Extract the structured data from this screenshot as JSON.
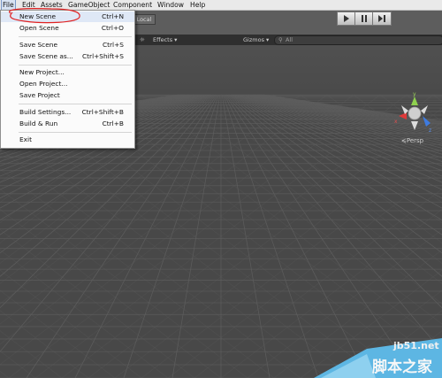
{
  "menubar": {
    "items": [
      "File",
      "Edit",
      "Assets",
      "GameObject",
      "Component",
      "Window",
      "Help"
    ]
  },
  "toolbar": {
    "play_icon": "play-icon",
    "pause_icon": "pause-icon",
    "step_icon": "step-icon",
    "pivot_space": "Local"
  },
  "scene_bar": {
    "effects": "Effects",
    "gizmos": "Gizmos",
    "search": "All"
  },
  "scene_view": {
    "projection": "Persp",
    "gizmo_axes": {
      "y": "y",
      "x": "x",
      "z": "z"
    }
  },
  "file_menu": {
    "items": [
      {
        "label": "New Scene",
        "shortcut": "Ctrl+N"
      },
      {
        "label": "Open Scene",
        "shortcut": "Ctrl+O"
      },
      {
        "label": "Save Scene",
        "shortcut": "Ctrl+S"
      },
      {
        "label": "Save Scene as...",
        "shortcut": "Ctrl+Shift+S"
      },
      {
        "label": "New Project...",
        "shortcut": ""
      },
      {
        "label": "Open Project...",
        "shortcut": ""
      },
      {
        "label": "Save Project",
        "shortcut": ""
      },
      {
        "label": "Build Settings...",
        "shortcut": "Ctrl+Shift+B"
      },
      {
        "label": "Build & Run",
        "shortcut": "Ctrl+B"
      },
      {
        "label": "Exit",
        "shortcut": ""
      }
    ]
  },
  "watermark": {
    "line1": "jb51.net",
    "line2": "脚本之家"
  },
  "colors": {
    "annotation_red": "#e02020",
    "menu_highlight": "#d8e3f3",
    "scene_background": "#484848"
  }
}
